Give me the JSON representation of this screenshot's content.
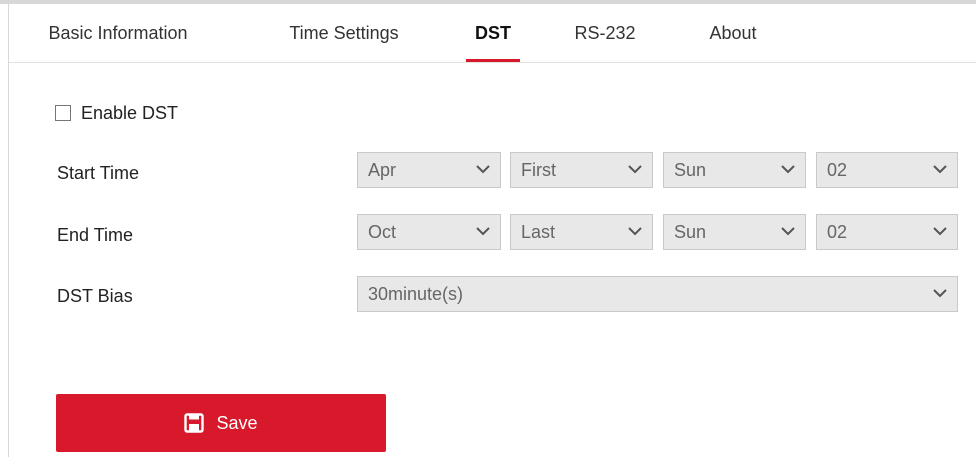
{
  "tabs": [
    {
      "label": "Basic Information",
      "active": false
    },
    {
      "label": "Time Settings",
      "active": false
    },
    {
      "label": "DST",
      "active": true
    },
    {
      "label": "RS-232",
      "active": false
    },
    {
      "label": "About",
      "active": false
    }
  ],
  "enable_dst": {
    "label": "Enable DST",
    "checked": false
  },
  "start_time": {
    "label": "Start Time",
    "month": "Apr",
    "week": "First",
    "day": "Sun",
    "hour": "02"
  },
  "end_time": {
    "label": "End Time",
    "month": "Oct",
    "week": "Last",
    "day": "Sun",
    "hour": "02"
  },
  "dst_bias": {
    "label": "DST Bias",
    "value": "30minute(s)"
  },
  "save_label": "Save",
  "colors": {
    "accent": "#d7192b",
    "select_bg": "#e8e8e8",
    "border": "#c9c9c9"
  },
  "icons": {
    "save": "floppy-disk-icon",
    "dropdown": "chevron-down-icon"
  }
}
